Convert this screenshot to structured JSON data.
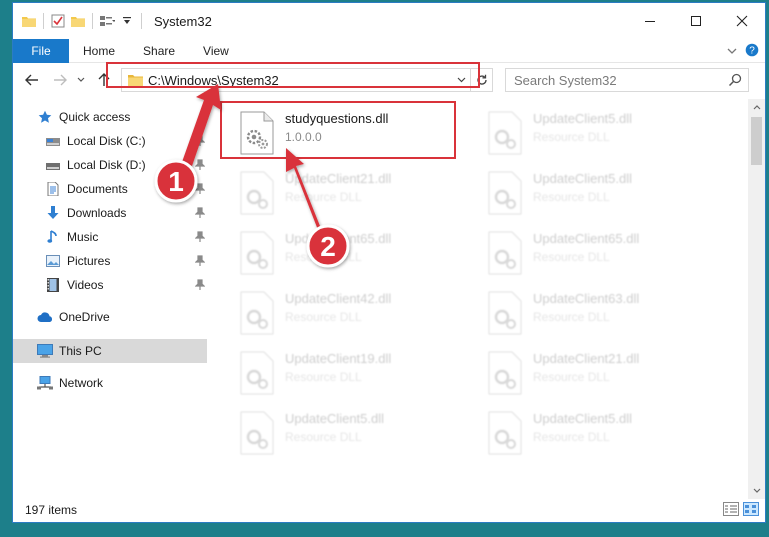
{
  "window": {
    "title": "System32",
    "min_label": "─",
    "max_label": "☐",
    "close_label": "✕"
  },
  "ribbon": {
    "file": "File",
    "tabs": [
      "Home",
      "Share",
      "View"
    ]
  },
  "address": {
    "path": "C:\\Windows\\System32"
  },
  "search": {
    "placeholder": "Search System32"
  },
  "nav": {
    "items": [
      {
        "label": "Quick access",
        "icon": "star-icon",
        "pinned": false
      },
      {
        "label": "Local Disk (C:)",
        "icon": "drive-icon",
        "pinned": true
      },
      {
        "label": "Local Disk (D:)",
        "icon": "drive-icon",
        "pinned": true
      },
      {
        "label": "Documents",
        "icon": "documents-icon",
        "pinned": true
      },
      {
        "label": "Downloads",
        "icon": "download-icon",
        "pinned": true
      },
      {
        "label": "Music",
        "icon": "music-icon",
        "pinned": true
      },
      {
        "label": "Pictures",
        "icon": "pictures-icon",
        "pinned": true
      },
      {
        "label": "Videos",
        "icon": "videos-icon",
        "pinned": true
      },
      {
        "label": "OneDrive",
        "icon": "cloud-icon",
        "pinned": false
      },
      {
        "label": "This PC",
        "icon": "computer-icon",
        "pinned": false
      },
      {
        "label": "Network",
        "icon": "network-icon",
        "pinned": false
      }
    ]
  },
  "files": {
    "highlighted": {
      "name": "studyquestions.dll",
      "version": "1.0.0.0"
    },
    "items": [
      {
        "name": "UpdateClient5.dll",
        "type": "Resource DLL"
      },
      {
        "name": "UpdateClient21.dll",
        "type": "Resource DLL"
      },
      {
        "name": "UpdateClient5.dll",
        "type": "Resource DLL"
      },
      {
        "name": "UpdateClient65.dll",
        "type": "Resource DLL"
      },
      {
        "name": "UpdateClient65.dll",
        "type": "Resource DLL"
      },
      {
        "name": "UpdateClient42.dll",
        "type": "Resource DLL"
      },
      {
        "name": "UpdateClient63.dll",
        "type": "Resource DLL"
      },
      {
        "name": "UpdateClient19.dll",
        "type": "Resource DLL"
      },
      {
        "name": "UpdateClient21.dll",
        "type": "Resource DLL"
      },
      {
        "name": "UpdateClient5.dll",
        "type": "Resource DLL"
      },
      {
        "name": "UpdateClient5.dll",
        "type": "Resource DLL"
      }
    ]
  },
  "status": {
    "count": "197 items"
  },
  "annotations": {
    "step1": "1",
    "step2": "2",
    "color": "#d9333a"
  },
  "colors": {
    "accent": "#1979ca",
    "desktop": "#1d7f8a",
    "selection": "#cce8ff"
  }
}
